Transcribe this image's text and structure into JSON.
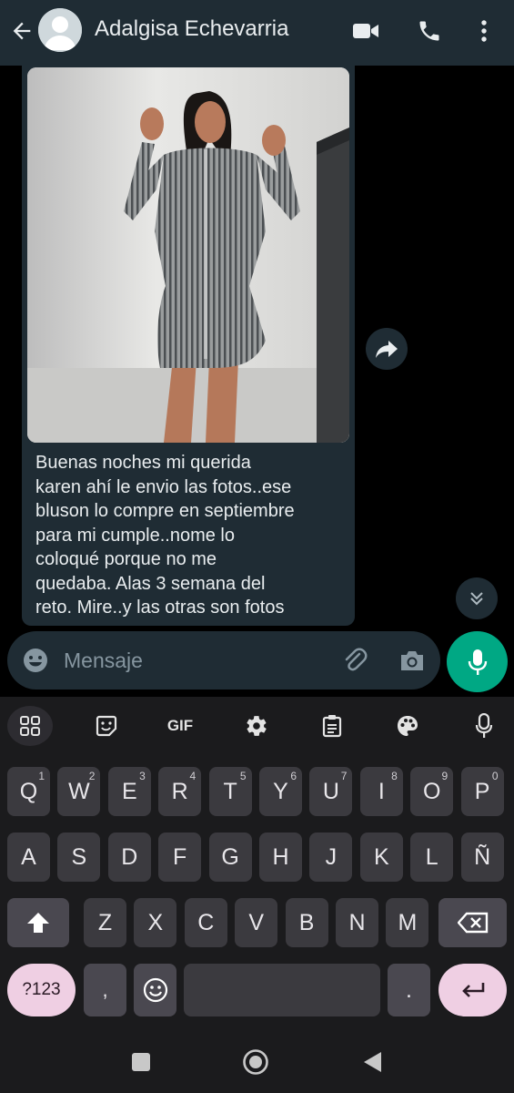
{
  "header": {
    "title": "Adalgisa Echevarria",
    "icons": [
      "back-arrow-icon",
      "avatar",
      "video-call-icon",
      "phone-icon",
      "more-options-icon"
    ]
  },
  "message": {
    "lines": [
      "Buenas noches mi querida",
      "karen  ahí  le envio  las fotos..ese",
      "bluson lo compre en septiembre",
      "para mi cumple..nome lo",
      "coloqué  porque no me",
      "quedaba. Alas 3 semana del",
      "reto. Mire..y las otras son fotos"
    ]
  },
  "composer": {
    "placeholder": "Mensaje"
  },
  "keyboard": {
    "toolbar": [
      "apps",
      "sticker",
      "GIF",
      "settings",
      "clipboard",
      "theme",
      "voice"
    ],
    "gif_label": "GIF",
    "row1": [
      {
        "k": "Q",
        "s": "1"
      },
      {
        "k": "W",
        "s": "2"
      },
      {
        "k": "E",
        "s": "3"
      },
      {
        "k": "R",
        "s": "4"
      },
      {
        "k": "T",
        "s": "5"
      },
      {
        "k": "Y",
        "s": "6"
      },
      {
        "k": "U",
        "s": "7"
      },
      {
        "k": "I",
        "s": "8"
      },
      {
        "k": "O",
        "s": "9"
      },
      {
        "k": "P",
        "s": "0"
      }
    ],
    "row2": [
      "A",
      "S",
      "D",
      "F",
      "G",
      "H",
      "J",
      "K",
      "L",
      "Ñ"
    ],
    "row3": [
      "Z",
      "X",
      "C",
      "V",
      "B",
      "N",
      "M"
    ],
    "symbols_label": "?123",
    "comma": ",",
    "period": "."
  },
  "colors": {
    "header_bg": "#1f2c34",
    "bubble_bg": "#1f2c34",
    "accent_green": "#00a884",
    "keyboard_bg": "#1b1b1d",
    "key_bg": "#3b3a3f",
    "pink_key": "#efcfe3"
  }
}
